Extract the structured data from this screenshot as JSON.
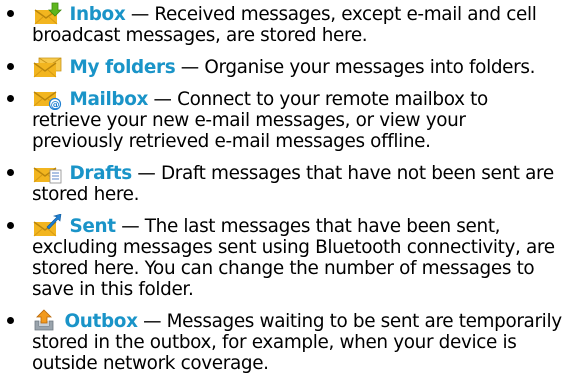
{
  "items": [
    {
      "icon": "inbox-icon",
      "name": "Inbox",
      "separator": " — ",
      "description": "Received messages, except e-mail and cell broadcast messages, are stored here."
    },
    {
      "icon": "my-folders-icon",
      "name": "My folders",
      "separator": " — ",
      "description": "Organise your messages into folders."
    },
    {
      "icon": "mailbox-icon",
      "name": "Mailbox",
      "separator": " — ",
      "description": "Connect to your remote mailbox to retrieve your new e-mail messages, or view your previously retrieved e-mail messages offline."
    },
    {
      "icon": "drafts-icon",
      "name": "Drafts",
      "separator": " — ",
      "description": "Draft messages that have not been sent are stored here."
    },
    {
      "icon": "sent-icon",
      "name": "Sent",
      "separator": " — ",
      "description": "The last messages that have been sent, excluding messages sent using Bluetooth connectivity, are stored here. You can change the number of messages to save in this folder."
    },
    {
      "icon": "outbox-icon",
      "name": "Outbox",
      "separator": " — ",
      "description": "Messages waiting to be sent are temporarily stored in the outbox, for example, when your device is outside network coverage."
    }
  ],
  "colors": {
    "link": "#1a94c8",
    "envelope": "#f2b51f",
    "arrow_green": "#5fb61e",
    "arrow_blue": "#1e7fd1"
  }
}
